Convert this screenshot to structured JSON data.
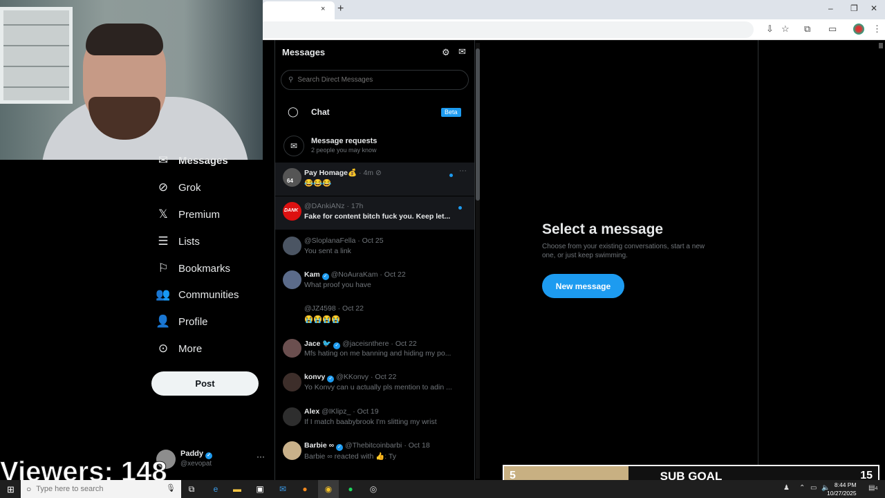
{
  "browser": {
    "tab_close": "×",
    "new_tab": "+",
    "window_controls": [
      "–",
      "❐",
      "✕"
    ]
  },
  "stream": {
    "viewers_text": "Viewers: 148",
    "sub_goal": {
      "current": "5",
      "label": "SUB GOAL",
      "target": "15",
      "progress": 0.333
    }
  },
  "nav": {
    "items": [
      {
        "label": "Messages",
        "icon": "mail-icon"
      },
      {
        "label": "Grok",
        "icon": "grok-icon"
      },
      {
        "label": "Premium",
        "icon": "x-logo-icon"
      },
      {
        "label": "Lists",
        "icon": "list-icon"
      },
      {
        "label": "Bookmarks",
        "icon": "bookmark-icon"
      },
      {
        "label": "Communities",
        "icon": "people-icon"
      },
      {
        "label": "Profile",
        "icon": "user-icon"
      },
      {
        "label": "More",
        "icon": "more-circle-icon"
      }
    ],
    "post_label": "Post",
    "account": {
      "name": "Paddy",
      "handle": "@xevopat",
      "more": "···"
    }
  },
  "messages": {
    "title": "Messages",
    "search_placeholder": "Search Direct Messages",
    "chat_label": "Chat",
    "beta_badge": "Beta",
    "requests_title": "Message requests",
    "requests_sub": "2 people you may know",
    "conversations": [
      {
        "name": "Pay Homage💰",
        "handle": "",
        "time": "· 4m",
        "text": "😂😂😂",
        "unread": true,
        "verified": false,
        "badge": "64"
      },
      {
        "name": "",
        "handle": "@DAnkiANz",
        "time": "· 17h",
        "text": "Fake for content bitch fuck you. Keep let...",
        "unread": true,
        "verified": false,
        "avatar_text": "DANK"
      },
      {
        "name": "",
        "handle": "@SloplanaFella",
        "time": "· Oct 25",
        "text": "You sent a link",
        "unread": false,
        "verified": false
      },
      {
        "name": "Kam",
        "handle": "@NoAuraKam",
        "time": "· Oct 22",
        "text": "What proof you have",
        "unread": false,
        "verified": true
      },
      {
        "name": "",
        "handle": "@JZ4598",
        "time": "· Oct 22",
        "text": "😭😭😭😭",
        "unread": false,
        "verified": false
      },
      {
        "name": "Jace 🐦",
        "handle": "@jaceisnthere",
        "time": "· Oct 22",
        "text": "Mfs hating on me banning and hiding my po...",
        "unread": false,
        "verified": true
      },
      {
        "name": "konvy",
        "handle": "@KKonvy",
        "time": "· Oct 22",
        "text": "Yo Konvy can u actually pls mention to adin ...",
        "unread": false,
        "verified": true
      },
      {
        "name": "Alex",
        "handle": "@IKlipz_",
        "time": "· Oct 19",
        "text": "If I match baabybrook I'm slitting my wrist",
        "unread": false,
        "verified": false
      },
      {
        "name": "Barbie ∞",
        "handle": "@Thebitcoinbarbi",
        "time": "· Oct 18",
        "text": "Barbie ∞ reacted with 👍: Ty",
        "unread": false,
        "verified": true
      }
    ]
  },
  "empty_state": {
    "title": "Select a message",
    "subtitle": "Choose from your existing conversations, start a new one, or just keep swimming.",
    "button": "New message"
  },
  "taskbar": {
    "search_placeholder": "Type here to search",
    "time": "8:44 PM",
    "date": "10/27/2025",
    "notification_count": "4"
  },
  "colors": {
    "accent": "#1d9bf0",
    "subgoal_fill": "#c8b082"
  }
}
